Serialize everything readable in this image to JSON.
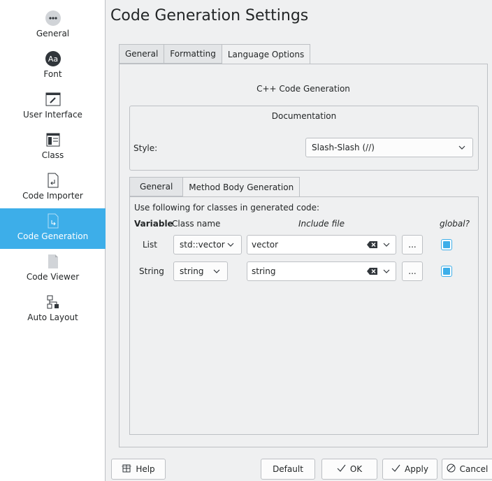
{
  "sidebar": {
    "items": [
      {
        "label": "General",
        "icon": "more-dots-icon"
      },
      {
        "label": "Font",
        "icon": "font-aa-icon"
      },
      {
        "label": "User Interface",
        "icon": "window-pen-icon"
      },
      {
        "label": "Class",
        "icon": "class-diagram-icon"
      },
      {
        "label": "Code Importer",
        "icon": "document-import-icon"
      },
      {
        "label": "Code Generation",
        "icon": "document-export-icon",
        "selected": true
      },
      {
        "label": "Code Viewer",
        "icon": "blank-document-icon"
      },
      {
        "label": "Auto Layout",
        "icon": "layout-tree-icon"
      }
    ]
  },
  "header": {
    "title": "Code Generation Settings"
  },
  "tabs": {
    "general": "General",
    "formatting": "Formatting",
    "language_options": "Language Options"
  },
  "language_options": {
    "heading": "C++ Code Generation",
    "documentation": {
      "title": "Documentation",
      "style_label": "Style:",
      "style_value": "Slash-Slash (//)"
    },
    "subtabs": {
      "general": "General",
      "method_body": "Method Body Generation"
    },
    "method_body": {
      "intro": "Use following for classes in generated code:",
      "col_variable": "Variable",
      "col_class_name": "Class name",
      "col_include_file": "Include file",
      "col_global": "global?",
      "rows": [
        {
          "variable": "List",
          "class_name": "std::vector",
          "include_file": "vector",
          "browse": "...",
          "global": true
        },
        {
          "variable": "String",
          "class_name": "string",
          "include_file": "string",
          "browse": "...",
          "global": true
        }
      ]
    }
  },
  "buttons": {
    "help": "Help",
    "default": "Default",
    "ok": "OK",
    "apply": "Apply",
    "cancel": "Cancel"
  },
  "colors": {
    "accent": "#3daee9",
    "background": "#eff0f1",
    "border": "#bdc0c4",
    "text": "#232627"
  }
}
